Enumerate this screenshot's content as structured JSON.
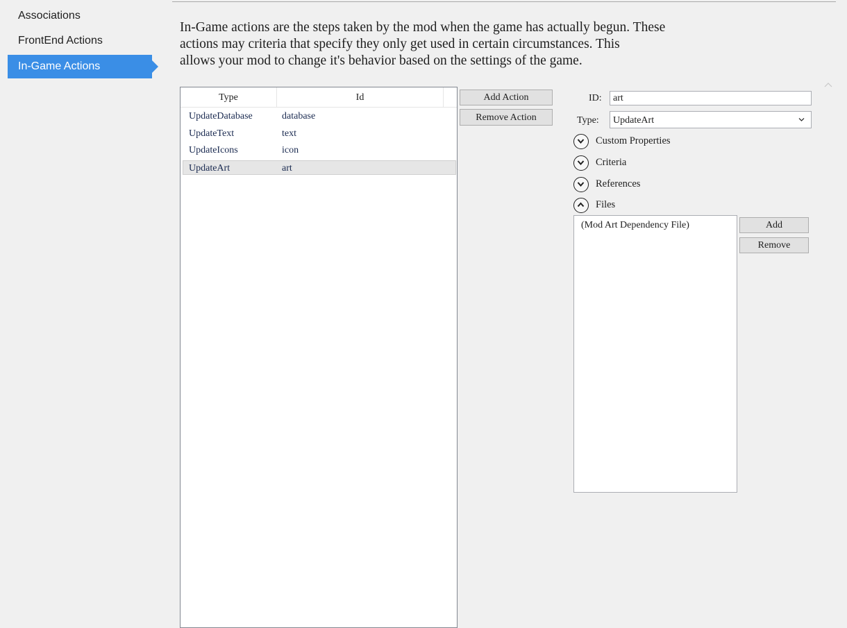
{
  "sidebar": {
    "items": [
      {
        "label": "Associations",
        "active": false
      },
      {
        "label": "FrontEnd Actions",
        "active": false
      },
      {
        "label": "In-Game Actions",
        "active": true
      }
    ]
  },
  "description": "In-Game actions are the steps taken by the mod when the game has actually begun.  These\nactions may criteria that specify they only get used in certain circumstances.  This\nallows your mod to change it's behavior based on the settings of the game.",
  "action_list": {
    "columns": [
      "Type",
      "Id"
    ],
    "rows": [
      {
        "type": "UpdateDatabase",
        "id": "database"
      },
      {
        "type": "UpdateText",
        "id": "text"
      },
      {
        "type": "UpdateIcons",
        "id": "icon"
      },
      {
        "type": "UpdateArt",
        "id": "art"
      }
    ],
    "selected_index": 3
  },
  "buttons": {
    "add_action": "Add Action",
    "remove_action": "Remove Action"
  },
  "detail": {
    "id_label": "ID:",
    "id_value": "art",
    "type_label": "Type:",
    "type_value": "UpdateArt",
    "sections": [
      {
        "label": "Custom Properties",
        "expanded": false
      },
      {
        "label": "Criteria",
        "expanded": false
      },
      {
        "label": "References",
        "expanded": false
      },
      {
        "label": "Files",
        "expanded": true
      }
    ],
    "files": {
      "items": [
        "(Mod Art Dependency File)"
      ],
      "add_label": "Add",
      "remove_label": "Remove"
    }
  },
  "colors": {
    "accent": "#3a8ee6",
    "background": "#f0f0f0"
  },
  "icons": {
    "collapsed": "chevron-down-icon",
    "expanded": "chevron-up-icon",
    "dropdown": "chevron-down-icon",
    "scroll": "scroll-up-icon"
  }
}
